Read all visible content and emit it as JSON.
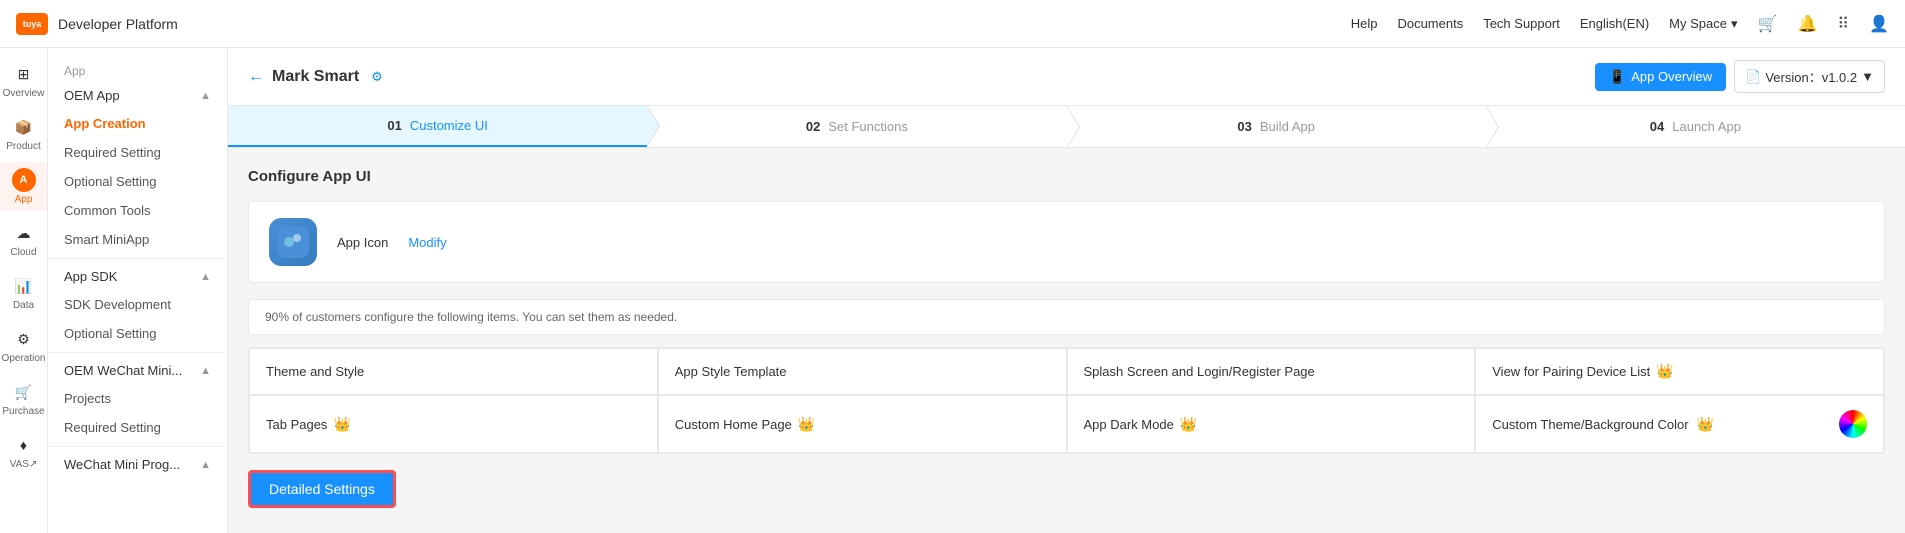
{
  "topNav": {
    "logo": "tuya",
    "title": "Developer Platform",
    "links": [
      "Help",
      "Documents",
      "Tech Support"
    ],
    "language": "English(EN)",
    "mySpace": "My Space"
  },
  "sidebar": {
    "icons": [
      {
        "id": "overview",
        "label": "Overview",
        "icon": "⊞",
        "active": false
      },
      {
        "id": "product",
        "label": "Product",
        "icon": "📦",
        "active": false
      },
      {
        "id": "app",
        "label": "App",
        "icon": "A",
        "active": true
      },
      {
        "id": "cloud",
        "label": "Cloud",
        "icon": "☁",
        "active": false
      },
      {
        "id": "data",
        "label": "Data",
        "icon": "📊",
        "active": false
      },
      {
        "id": "operation",
        "label": "Operation",
        "icon": "⚙",
        "active": false
      },
      {
        "id": "purchase",
        "label": "Purchase",
        "icon": "🛒",
        "active": false
      },
      {
        "id": "vas",
        "label": "VAS↗",
        "icon": "♦",
        "active": false
      }
    ],
    "menu": {
      "appLabel": "App",
      "sections": [
        {
          "title": "OEM App",
          "collapsible": true,
          "items": [
            "App Creation",
            "Required Setting",
            "Optional Setting",
            "Common Tools",
            "Smart MiniApp"
          ]
        },
        {
          "title": "App SDK",
          "collapsible": true,
          "items": [
            "SDK Development",
            "Optional Setting"
          ]
        },
        {
          "title": "OEM WeChat Mini...",
          "collapsible": true,
          "items": [
            "Projects",
            "Required Setting"
          ]
        },
        {
          "title": "WeChat Mini Prog...",
          "collapsible": true,
          "items": []
        }
      ]
    }
  },
  "contentHeader": {
    "backLabel": "←",
    "appName": "Mark Smart",
    "settingsDot": "⚙",
    "appOverviewBtn": "App Overview",
    "versionLabel": "Version：v1.0.2",
    "versionDropdown": "▼"
  },
  "appLabel": "App",
  "steps": [
    {
      "num": "01",
      "label": "Customize UI",
      "active": true
    },
    {
      "num": "02",
      "label": "Set Functions",
      "active": false
    },
    {
      "num": "03",
      "label": "Build App",
      "active": false
    },
    {
      "num": "04",
      "label": "Launch App",
      "active": false
    }
  ],
  "pageTitle": "Configure App UI",
  "appIcon": {
    "label": "App Icon",
    "modifyLabel": "Modify"
  },
  "infoText": "90% of customers configure the following items. You can set them as needed.",
  "cards": [
    {
      "label": "Theme and Style",
      "crown": false
    },
    {
      "label": "App Style Template",
      "crown": false
    },
    {
      "label": "Splash Screen and Login/Register Page",
      "crown": false
    },
    {
      "label": "View for Pairing Device List",
      "crown": true
    },
    {
      "label": "Tab Pages",
      "crown": true
    },
    {
      "label": "Custom Home Page",
      "crown": true
    },
    {
      "label": "App Dark Mode",
      "crown": true
    },
    {
      "label": "Custom Theme/Background Color",
      "crown": true
    }
  ],
  "detailedBtn": "Detailed Settings"
}
